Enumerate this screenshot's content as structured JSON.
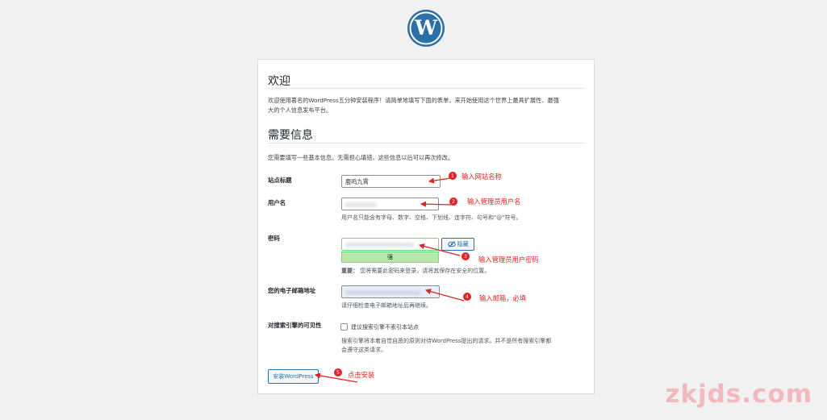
{
  "colors": {
    "background": "#f1f1f1",
    "card": "#ffffff",
    "accent": "#2271b1",
    "annotation": "#e02424",
    "strength_good": "#b8e6b0"
  },
  "logo": {
    "icon": "wordpress-logo-icon"
  },
  "welcome": {
    "heading": "欢迎",
    "text_line1": "欢迎使用著名的WordPress五分钟安装程序！请简单地填写下面的表单，来开始使用这个世界上最具扩展性、最强",
    "text_line2": "大的个人信息发布平台。"
  },
  "info": {
    "heading": "需要信息",
    "text": "您需要填写一些基本信息。无需担心填错，这些信息以后可以再次修改。"
  },
  "form": {
    "site_title": {
      "label": "站点标题",
      "value": "鹿鸣九霄"
    },
    "username": {
      "label": "用户名",
      "value": "xxxxxxxxx",
      "hint": "用户名只能含有字母、数字、空格、下划线、连字符、句号和\"@\"符号。"
    },
    "password": {
      "label": "密码",
      "value": "xxxxxxxxxxxxxxxxxxxx",
      "hide_label": "隐藏",
      "strength": "强",
      "important_label": "重要：",
      "important_text": "您将需要此密码来登录，请将其保存在安全的位置。"
    },
    "email": {
      "label": "您的电子邮箱地址",
      "value": "xxxxxxxxxxxxxxxxxxxxxx",
      "hint": "请仔细检查电子邮箱地址后再继续。"
    },
    "visibility": {
      "label": "对搜索引擎的可见性",
      "checkbox_label": "建议搜索引擎不索引本站点",
      "checked": false,
      "desc_line1": "搜索引擎将本着自觉自愿的原则对待WordPress提出的请求。并不是所有搜索引擎都",
      "desc_line2": "会遵守这类请求。"
    },
    "install_button": "安装WordPress"
  },
  "annotations": [
    {
      "num": "1",
      "text": "输入网站名称"
    },
    {
      "num": "2",
      "text": "输入管理员用户名"
    },
    {
      "num": "3",
      "text": "输入管理员用户密码"
    },
    {
      "num": "4",
      "text": "输入邮箱，必填"
    },
    {
      "num": "5",
      "text": "点击安装"
    }
  ],
  "watermark": "zkjds.com"
}
